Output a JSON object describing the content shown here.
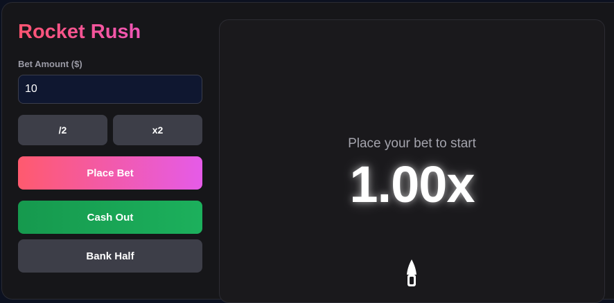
{
  "game": {
    "title": "Rocket Rush"
  },
  "bet": {
    "label": "Bet Amount ($)",
    "value": "10"
  },
  "controls": {
    "half_label": "/2",
    "double_label": "x2",
    "place_bet_label": "Place Bet",
    "cash_out_label": "Cash Out",
    "bank_half_label": "Bank Half"
  },
  "display": {
    "status": "Place your bet to start",
    "multiplier": "1.00x"
  },
  "icons": {
    "rocket": "rocket-icon"
  },
  "colors": {
    "title_gradient_start": "#ff5470",
    "title_gradient_end": "#ef56b6",
    "place_bet_start": "#ff5a6e",
    "place_bet_end": "#e55be8",
    "cash_out": "#16a556",
    "neutral_button": "#3d3e48",
    "panel_bg": "#1a191c"
  }
}
